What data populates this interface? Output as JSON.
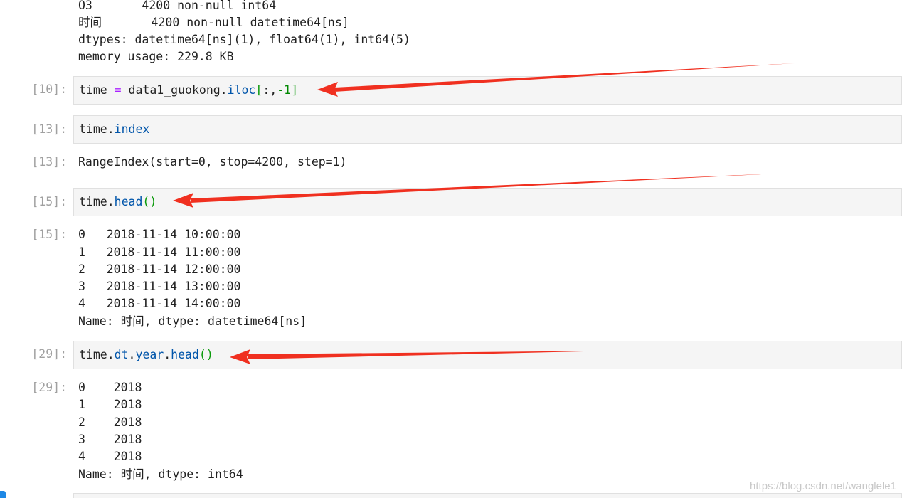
{
  "top_output": {
    "lines": [
      "O3       4200 non-null int64",
      "时间       4200 non-null datetime64[ns]",
      "dtypes: datetime64[ns](1), float64(1), int64(5)",
      "memory usage: 229.8 KB"
    ]
  },
  "cells": {
    "c10": {
      "prompt": "[10]:",
      "tok1": "time ",
      "tok2": "=",
      "tok3": " data1_guokong.",
      "tok4": "iloc",
      "tok5": "[",
      "tok6": ":,",
      "tok7": "-1",
      "tok8": "]"
    },
    "c13": {
      "prompt": "[13]:",
      "tok1": "time.",
      "tok2": "index",
      "out_prompt": "[13]:",
      "output": "RangeIndex(start=0, stop=4200, step=1)"
    },
    "c15": {
      "prompt": "[15]:",
      "tok1": "time.",
      "tok2": "head",
      "tok3": "()",
      "out_prompt": "[15]:",
      "output": [
        "0   2018-11-14 10:00:00",
        "1   2018-11-14 11:00:00",
        "2   2018-11-14 12:00:00",
        "3   2018-11-14 13:00:00",
        "4   2018-11-14 14:00:00",
        "Name: 时间, dtype: datetime64[ns]"
      ]
    },
    "c29": {
      "prompt": "[29]:",
      "tok1": "time.",
      "tok2": "dt",
      "tok3": ".",
      "tok4": "year",
      "tok5": ".",
      "tok6": "head",
      "tok7": "()",
      "out_prompt": "[29]:",
      "output": [
        "0    2018",
        "1    2018",
        "2    2018",
        "3    2018",
        "4    2018",
        "Name: 时间, dtype: int64"
      ]
    }
  },
  "watermark": "https://blog.csdn.net/wanglele1",
  "colors": {
    "arrow": "#f03020",
    "prompt": "#a0a0a0",
    "cell_bg": "#f5f5f5"
  }
}
